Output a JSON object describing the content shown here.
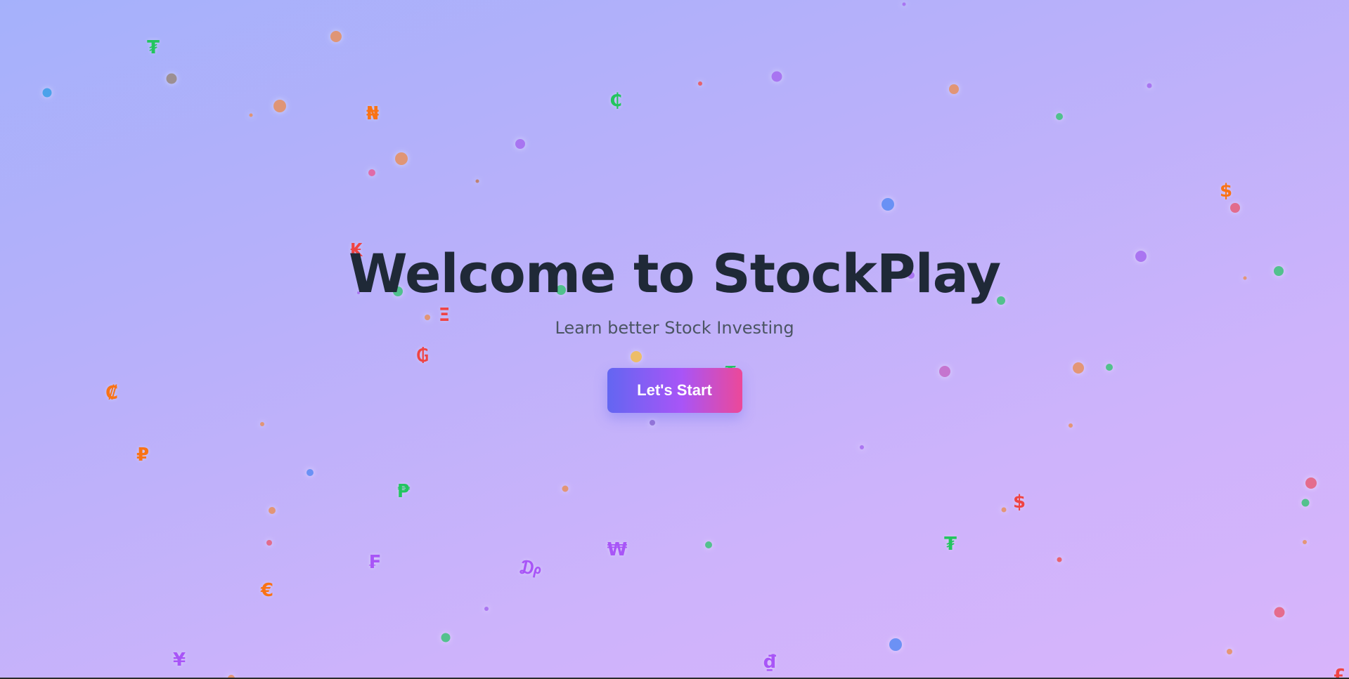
{
  "hero": {
    "title": "Welcome to StockPlay",
    "subtitle": "Learn better Stock Investing",
    "button_label": "Let's Start"
  },
  "colors": {
    "title": "#1f2937",
    "subtitle": "#4b5563",
    "button_gradient": [
      "#6366f1",
      "#a855f7",
      "#ec4899"
    ]
  },
  "currency_symbols": [
    {
      "char": "₮",
      "color": "#22c55e"
    },
    {
      "char": "₦",
      "color": "#f97316"
    },
    {
      "char": "₵",
      "color": "#22c55e"
    },
    {
      "char": "$",
      "color": "#f97316"
    },
    {
      "char": "₭",
      "color": "#ef4444"
    },
    {
      "char": "Ξ",
      "color": "#ef4444"
    },
    {
      "char": "₲",
      "color": "#ef4444"
    },
    {
      "char": "₹",
      "color": "#22c55e"
    },
    {
      "char": "₡",
      "color": "#f97316"
    },
    {
      "char": "₽",
      "color": "#f97316"
    },
    {
      "char": "₱",
      "color": "#22c55e"
    },
    {
      "char": "$",
      "color": "#ef4444"
    },
    {
      "char": "₮",
      "color": "#22c55e"
    },
    {
      "char": "₩",
      "color": "#a855f7"
    },
    {
      "char": "₣",
      "color": "#a855f7"
    },
    {
      "char": "₯",
      "color": "#a855f7"
    },
    {
      "char": "€",
      "color": "#f97316"
    },
    {
      "char": "¥",
      "color": "#a855f7"
    },
    {
      "char": "₫",
      "color": "#a855f7"
    },
    {
      "char": "£",
      "color": "#ef4444"
    }
  ]
}
